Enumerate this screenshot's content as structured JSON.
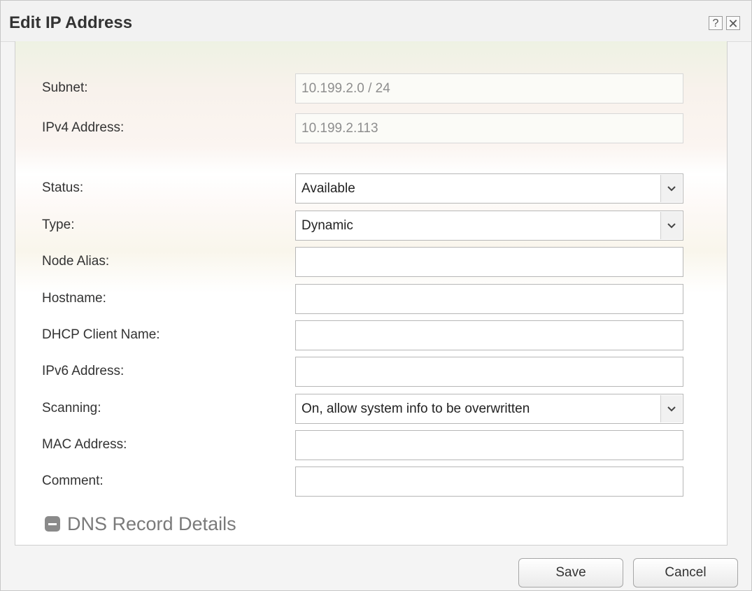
{
  "dialog": {
    "title": "Edit IP Address",
    "help_label": "?",
    "close_label": "✕"
  },
  "form": {
    "subnet": {
      "label": "Subnet:",
      "value": "10.199.2.0 / 24"
    },
    "ipv4": {
      "label": "IPv4 Address:",
      "value": "10.199.2.113"
    },
    "status": {
      "label": "Status:",
      "value": "Available"
    },
    "type": {
      "label": "Type:",
      "value": "Dynamic"
    },
    "node_alias": {
      "label": "Node Alias:",
      "value": ""
    },
    "hostname": {
      "label": "Hostname:",
      "value": ""
    },
    "dhcp_client_name": {
      "label": "DHCP Client Name:",
      "value": ""
    },
    "ipv6": {
      "label": "IPv6 Address:",
      "value": ""
    },
    "scanning": {
      "label": "Scanning:",
      "value": "On, allow system info to be overwritten"
    },
    "mac": {
      "label": "MAC Address:",
      "value": ""
    },
    "comment": {
      "label": "Comment:",
      "value": ""
    }
  },
  "dns_section": {
    "label": "DNS Record Details",
    "icon": "minus-icon"
  },
  "buttons": {
    "save": "Save",
    "cancel": "Cancel"
  },
  "icons": {
    "dropdown": "chevron-down-icon",
    "scroll_up": "arrow-up-icon",
    "scroll_down": "arrow-down-icon"
  }
}
